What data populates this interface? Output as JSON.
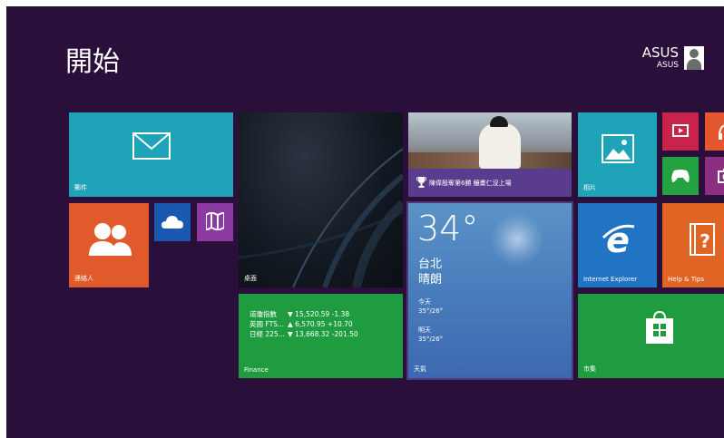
{
  "header": {
    "title": "開始"
  },
  "user": {
    "name": "ASUS",
    "sub": "ASUS"
  },
  "tiles": {
    "mail": {
      "label": "郵件"
    },
    "people": {
      "label": "連絡人"
    },
    "onedrive": {
      "icon": "cloud-icon"
    },
    "maps": {
      "icon": "map-icon"
    },
    "desktop": {
      "label": "桌面"
    },
    "finance": {
      "label": "Finance",
      "rows": [
        {
          "name": "道瓊指數",
          "value": "▼ 15,520.59 -1.38"
        },
        {
          "name": "英國 FTS...",
          "value": "▲ 6,570.95 +10.70"
        },
        {
          "name": "日經 225...",
          "value": "▼ 13,668.32 -201.50"
        }
      ]
    },
    "sports": {
      "headline": "陳偉殷奪第6勝 釀畫仁沒上場"
    },
    "weather": {
      "label": "天氣",
      "temp": "34°",
      "city": "台北",
      "condition": "晴朗",
      "today_label": "今天",
      "today_value": "35°/26°",
      "tomorrow_label": "明天",
      "tomorrow_value": "35°/26°"
    },
    "photos": {
      "label": "相片"
    },
    "ie": {
      "label": "Internet Explorer"
    },
    "help": {
      "label": "Help & Tips"
    },
    "store": {
      "label": "市集"
    }
  },
  "colors": {
    "background": "#2a0f3b",
    "teal": "#1ea3b8",
    "orange": "#e05a2b",
    "green": "#1f9c3f",
    "blue": "#2173c4"
  }
}
